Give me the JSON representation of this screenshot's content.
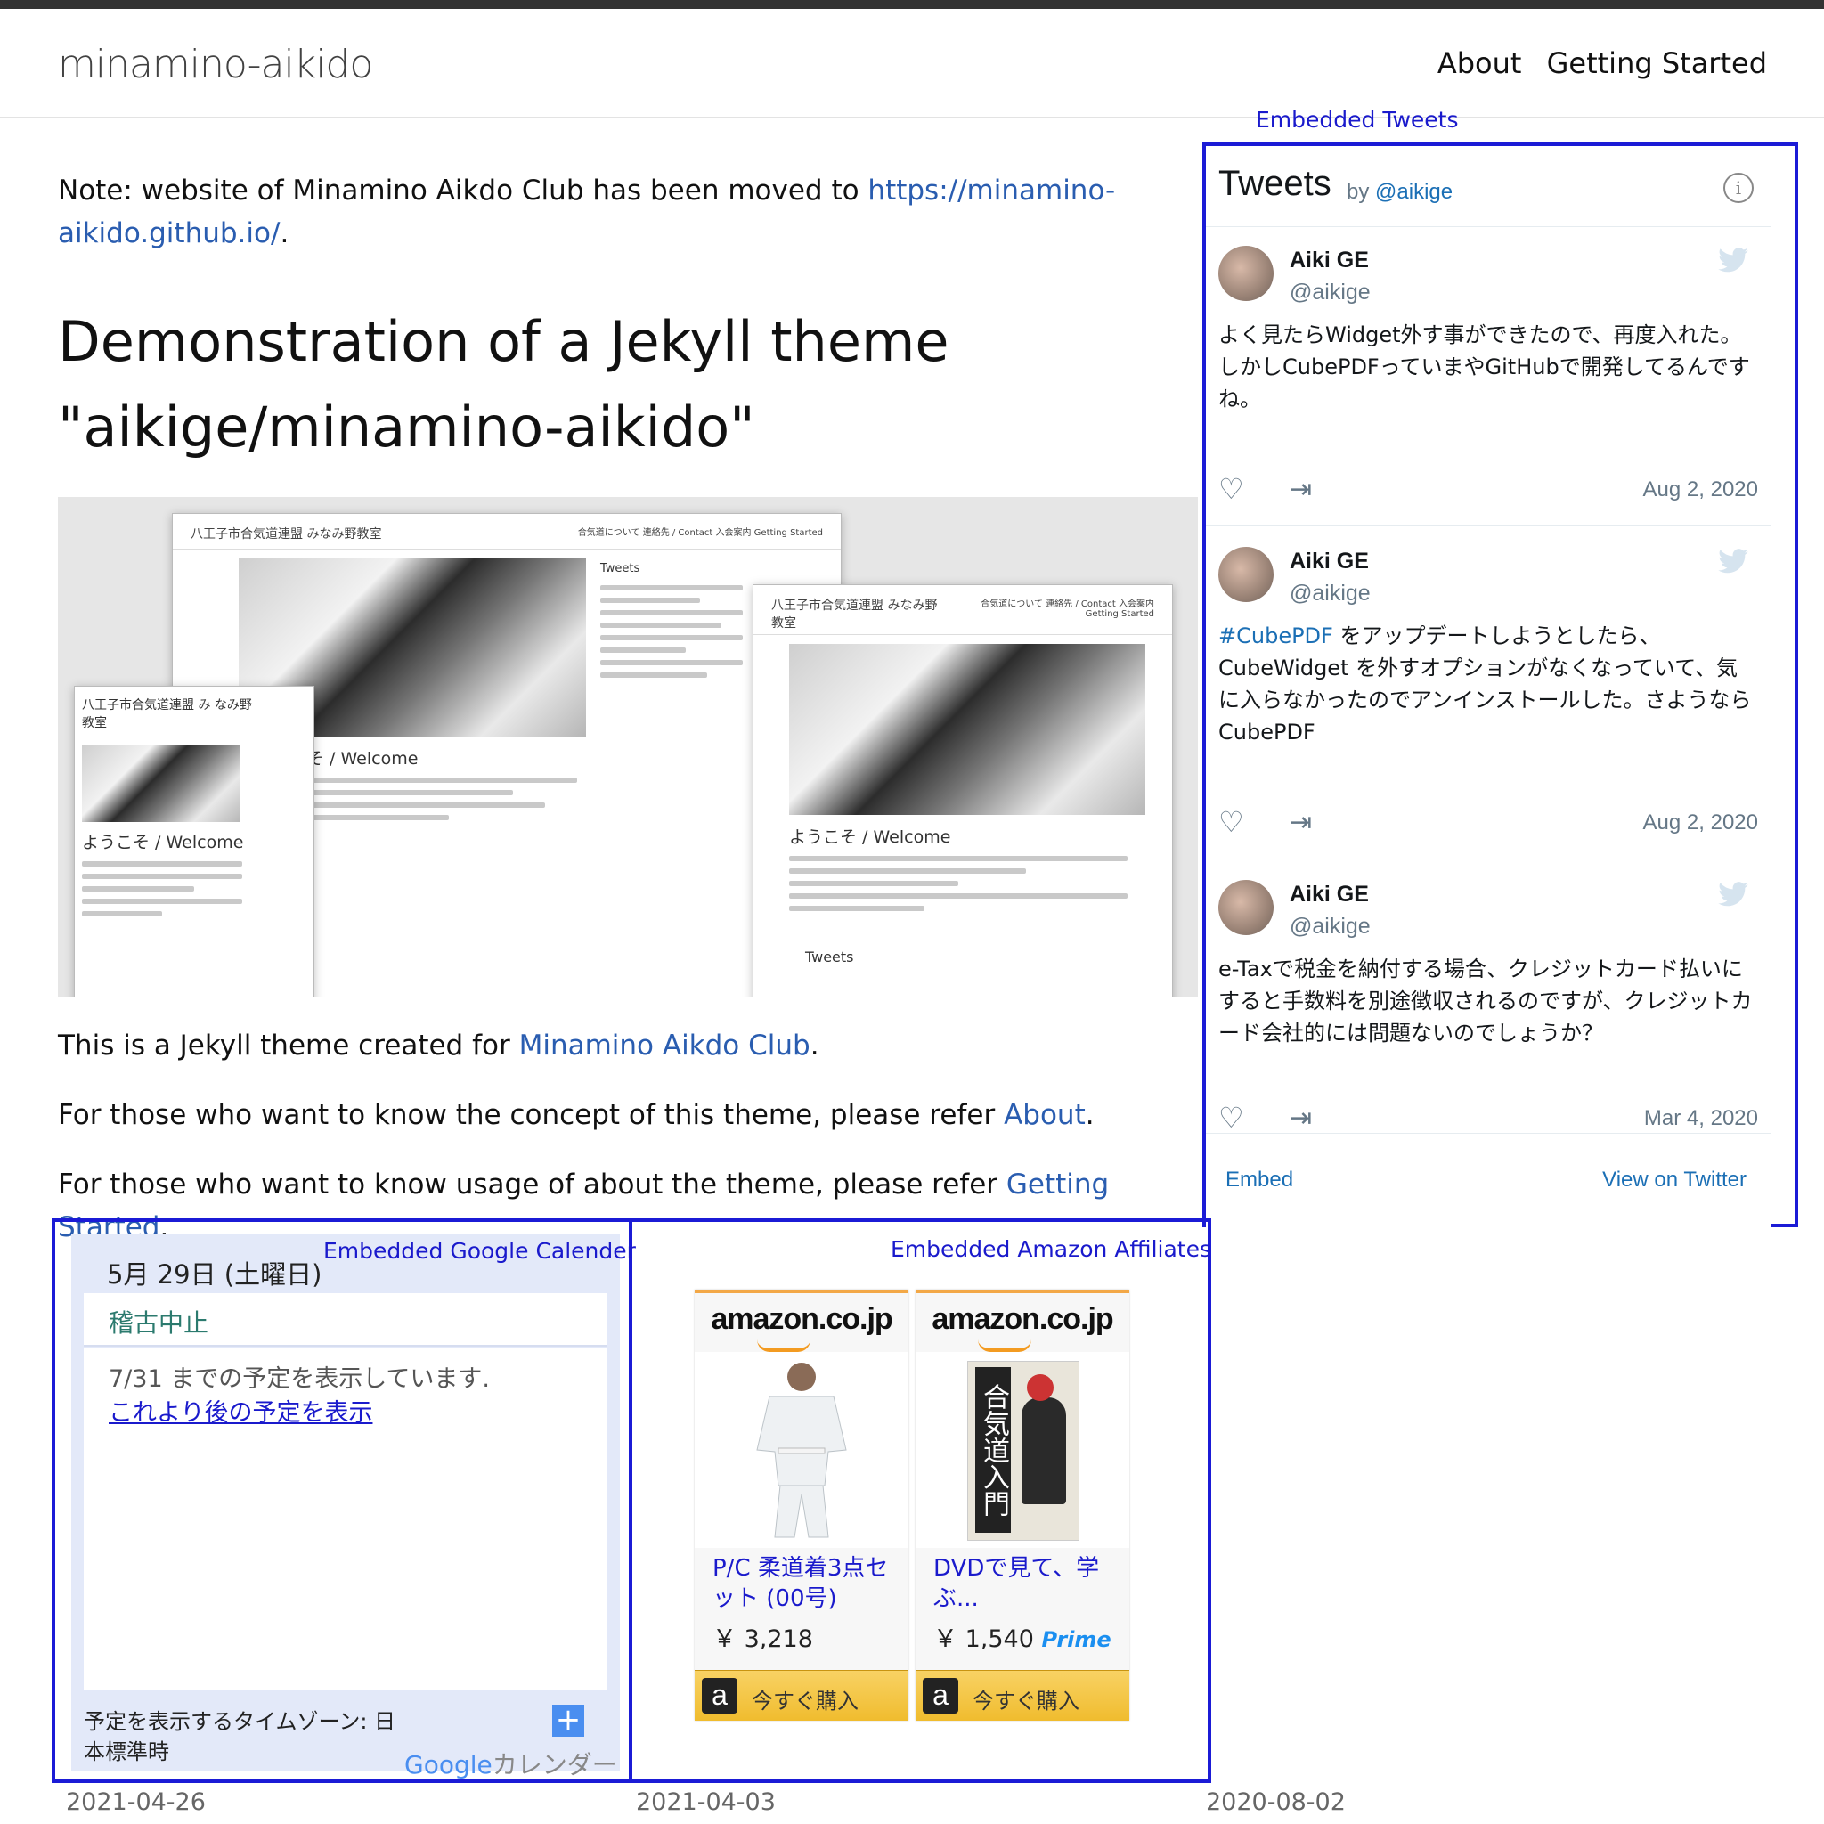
{
  "site": {
    "title": "minamino-aikido"
  },
  "nav": {
    "about": "About",
    "getting_started": "Getting Started"
  },
  "main": {
    "note_prefix": "Note: website of Minamino Aikdo Club has been moved to ",
    "note_link": "https://minamino-aikido.github.io/",
    "note_suffix": ".",
    "heading": "Demonstration of a Jekyll theme \"aikige/minamino-aikido\"",
    "p1_prefix": "This is a Jekyll theme created for ",
    "p1_link": "Minamino Aikdo Club",
    "p1_suffix": ".",
    "p2_prefix": "For those who want to know the concept of this theme, please refer ",
    "p2_link": "About",
    "p2_suffix": ".",
    "p3_prefix": "For those who want to know usage of about the theme, please refer ",
    "p3_link": "Getting Started",
    "p3_suffix": "."
  },
  "mock": {
    "win1_title": "八王子市合気道連盟 みなみ野教室",
    "win1_nav": "合気道について 連絡先 / Contact 入会案内 Getting Started",
    "win2_title": "八王子市合気道連盟 み なみ野教室",
    "win3_title": "八王子市合気道連盟 みなみ野 教室",
    "win3_nav": "合気道について 連絡先 / Contact 入会案内 Getting Started",
    "welcome": "ようこそ / Welcome",
    "tweets": "Tweets"
  },
  "labels": {
    "tweets": "Embedded Tweets",
    "calendar": "Embedded Google Calender",
    "amazon": "Embedded Amazon Affiliates"
  },
  "tweets_widget": {
    "title": "Tweets",
    "by": "by",
    "by_handle": "@aikige",
    "info": "i",
    "tweets": [
      {
        "name": "Aiki GE",
        "handle": "@aikige",
        "text": "よく見たらWidget外す事ができたので、再度入れた。しかしCubePDFっていまやGitHubで開発してるんですね。",
        "date": "Aug 2, 2020"
      },
      {
        "name": "Aiki GE",
        "handle": "@aikige",
        "hashtag": "#CubePDF",
        "text": " をアップデートしようとしたら、CubeWidget を外すオプションがなくなっていて、気に入らなかったのでアンインストールした。さようなら CubePDF",
        "date": "Aug 2, 2020"
      },
      {
        "name": "Aiki GE",
        "handle": "@aikige",
        "text": "e-Taxで税金を納付する場合、クレジットカード払いにすると手数料を別途徴収されるのですが、クレジットカード会社的には問題ないのでしょうか？",
        "date": "Mar 4, 2020"
      }
    ],
    "embed": "Embed",
    "view": "View on Twitter"
  },
  "calendar": {
    "date": "5月 29日 (土曜日)",
    "event": "稽古中止",
    "range": "7/31 までの予定を表示しています.",
    "more": "これより後の予定を表示",
    "timezone": "予定を表示するタイムゾーン: 日本標準時",
    "plus": "+",
    "logo_google": "Google",
    "logo_cal": "カレンダー"
  },
  "amazon": {
    "logo": "amazon.co.jp",
    "items": [
      {
        "title": "P/C 柔道着3点セット (00号)",
        "price": "￥ 3,218",
        "prime": "",
        "buy": "今すぐ購入"
      },
      {
        "title": "DVDで見て、学ぶ...",
        "price": "￥ 1,540",
        "prime": "Prime",
        "buy": "今すぐ購入"
      }
    ],
    "book_cover": "合気道入門"
  },
  "dates": [
    "2021-04-26",
    "2021-04-03",
    "2020-08-02"
  ],
  "colors": {
    "link": "#2a5db0",
    "annotation": "#1b1bd6",
    "twitter_link": "#1b6fb5"
  }
}
